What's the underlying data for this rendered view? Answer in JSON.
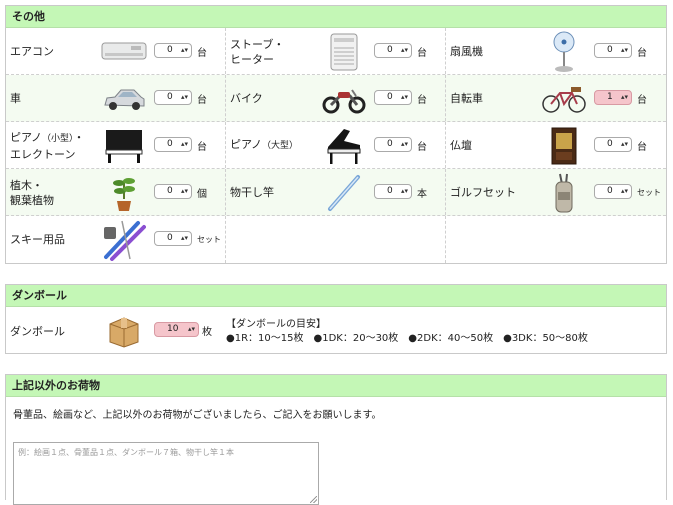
{
  "sections": {
    "other": {
      "title": "その他",
      "items": [
        {
          "name": "エアコン",
          "value": "0",
          "unit": "台",
          "icon": "air-conditioner-icon"
        },
        {
          "name_line1": "ストーブ・",
          "name_line2": "ヒーター",
          "value": "0",
          "unit": "台",
          "icon": "heater-icon"
        },
        {
          "name": "扇風機",
          "value": "0",
          "unit": "台",
          "icon": "electric-fan-icon"
        },
        {
          "name": "車",
          "value": "0",
          "unit": "台",
          "icon": "car-icon"
        },
        {
          "name": "バイク",
          "value": "0",
          "unit": "台",
          "icon": "motorcycle-icon"
        },
        {
          "name": "自転車",
          "value": "1",
          "unit": "台",
          "icon": "bicycle-icon"
        },
        {
          "name_line1": "ピアノ",
          "name_small1": "（小型）",
          "name_sep": "・",
          "name_line2": "エレクトーン",
          "value": "0",
          "unit": "台",
          "icon": "upright-piano-icon"
        },
        {
          "name": "ピアノ",
          "name_small": "（大型）",
          "value": "0",
          "unit": "台",
          "icon": "grand-piano-icon"
        },
        {
          "name": "仏壇",
          "value": "0",
          "unit": "台",
          "icon": "buddhist-altar-icon"
        },
        {
          "name_line1": "植木・",
          "name_line2": "観葉植物",
          "value": "0",
          "unit": "個",
          "icon": "potted-plant-icon"
        },
        {
          "name": "物干し竿",
          "value": "0",
          "unit": "本",
          "icon": "laundry-pole-icon"
        },
        {
          "name": "ゴルフセット",
          "value": "0",
          "unit": "セット",
          "icon": "golf-bag-icon"
        },
        {
          "name": "スキー用品",
          "value": "0",
          "unit": "セット",
          "icon": "ski-equipment-icon"
        }
      ]
    },
    "cardboard": {
      "title": "ダンボール",
      "name": "ダンボール",
      "value": "10",
      "unit": "枚",
      "icon": "cardboard-box-icon",
      "guide_title": "【ダンボールの目安】",
      "guide": [
        "●1R：10〜15枚",
        "●1DK：20〜30枚",
        "●2DK：40〜50枚",
        "●3DK：50〜80枚"
      ]
    },
    "extra": {
      "title": "上記以外のお荷物",
      "description": "骨董品、絵画など、上記以外のお荷物がございましたら、ご記入をお願いします。",
      "placeholder": "例：絵画１点、骨董品１点、ダンボール７箱、物干し竿１本"
    }
  },
  "colors": {
    "header_bg": "#c4f7b6",
    "alt_row_bg": "#f4fbf1",
    "highlight_select": "#f5c5cb"
  }
}
